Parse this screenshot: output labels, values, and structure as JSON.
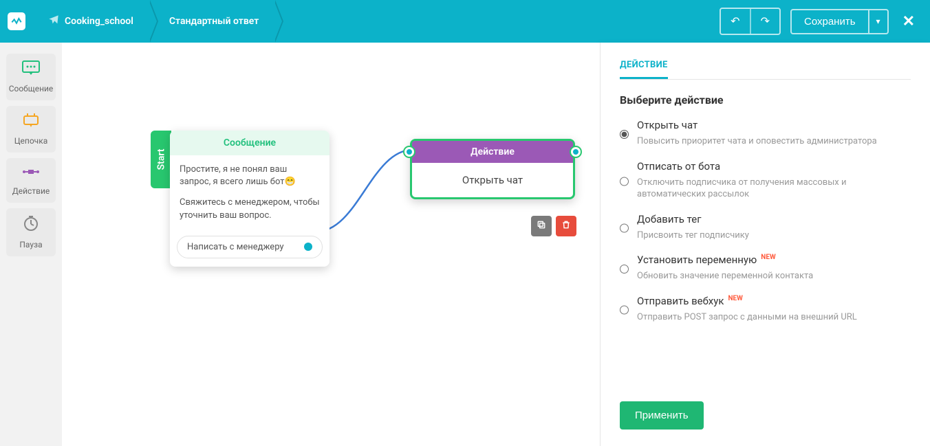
{
  "topbar": {
    "logo_glyph": "⋀",
    "bot_name": "Cooking_school",
    "page_title": "Стандартный ответ",
    "undo_glyph": "↶",
    "redo_glyph": "↷",
    "save_label": "Сохранить",
    "save_dd_glyph": "▾",
    "close_glyph": "✕"
  },
  "rail": {
    "message": "Сообщение",
    "chain": "Цепочка",
    "action": "Действие",
    "pause": "Пауза"
  },
  "canvas": {
    "start_label": "Start",
    "msg_header": "Сообщение",
    "msg_line1": "Простите, я не понял ваш запрос, я всего лишь бот😁",
    "msg_line2": "Свяжитесь с менеджером, чтобы уточнить ваш вопрос.",
    "msg_button": "Написать с менеджеру",
    "action_header": "Действие",
    "action_body": "Открыть чат",
    "tool_dup_glyph": "⧉",
    "tool_del_glyph": "🗑"
  },
  "panel": {
    "tab": "ДЕЙСТВИЕ",
    "heading": "Выберите действие",
    "actions": [
      {
        "id": "open_chat",
        "title": "Открыть чат",
        "desc": "Повысить приоритет чата и оповестить администратора",
        "new": false,
        "checked": true
      },
      {
        "id": "unsubscribe",
        "title": "Отписать от бота",
        "desc": "Отключить подписчика от получения массовых и автоматических рассылок",
        "new": false,
        "checked": false
      },
      {
        "id": "add_tag",
        "title": "Добавить тег",
        "desc": "Присвоить тег подписчику",
        "new": false,
        "checked": false
      },
      {
        "id": "set_var",
        "title": "Установить переменную",
        "desc": "Обновить значение переменной контакта",
        "new": true,
        "checked": false
      },
      {
        "id": "webhook",
        "title": "Отправить вебхук",
        "desc": "Отправить POST запрос с данными на внешний URL",
        "new": true,
        "checked": false
      }
    ],
    "new_badge": "NEW",
    "apply": "Применить"
  }
}
